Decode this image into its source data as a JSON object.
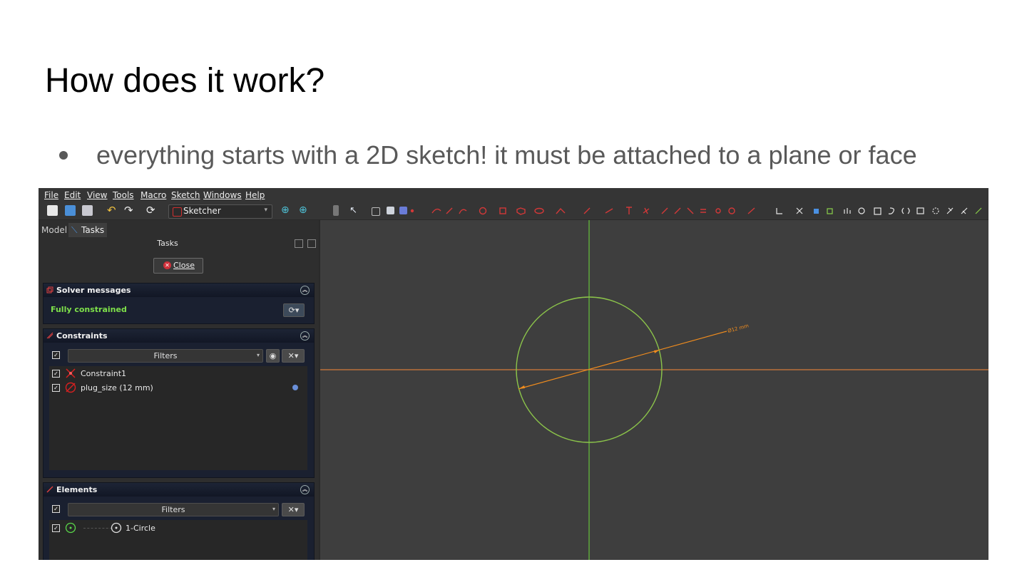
{
  "slide": {
    "title": "How does it work?",
    "bullet": "everything starts with a 2D sketch! it must be attached to a plane or face"
  },
  "menu": [
    "File",
    "Edit",
    "View",
    "Tools",
    "Macro",
    "Sketch",
    "Windows",
    "Help"
  ],
  "toolbar": {
    "workbench": "Sketcher"
  },
  "tabs": {
    "model": "Model",
    "tasks": "Tasks"
  },
  "tasks_panel": {
    "title": "Tasks",
    "close_label": "Close"
  },
  "solver": {
    "title": "Solver messages",
    "status": "Fully constrained",
    "status_color": "#7ee04a"
  },
  "constraints": {
    "title": "Constraints",
    "filters_label": "Filters",
    "items": [
      {
        "label": "Constraint1",
        "icon": "coincident-icon"
      },
      {
        "label": "plug_size (12 mm)",
        "icon": "diameter-icon"
      }
    ]
  },
  "elements": {
    "title": "Elements",
    "filters_label": "Filters",
    "items": [
      {
        "label": "1-Circle",
        "icon": "circle-icon"
      }
    ]
  },
  "viewport": {
    "dimension_label": "Ø12 mm",
    "axis_vertical_color": "#66c23a",
    "axis_horizontal_color": "#d47a3a",
    "circle_color": "#8bc34a",
    "dimension_color": "#f08c1e"
  }
}
